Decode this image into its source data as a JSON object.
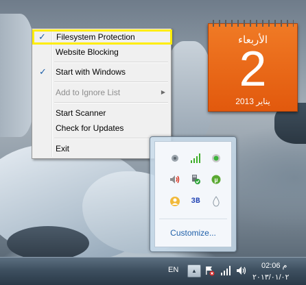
{
  "calendar": {
    "day_name": "الأربعاء",
    "day_number": "2",
    "month_year": "يناير 2013"
  },
  "context_menu": {
    "items": [
      {
        "label": "Filesystem Protection",
        "checked": true,
        "highlighted": true
      },
      {
        "label": "Website Blocking",
        "checked": false
      },
      {
        "label": "Start with Windows",
        "checked": true
      },
      {
        "label": "Add to Ignore List",
        "disabled": true,
        "submenu": true
      },
      {
        "label": "Start Scanner"
      },
      {
        "label": "Check for Updates"
      },
      {
        "label": "Exit"
      }
    ],
    "check_glyph": "✓",
    "submenu_glyph": "▶"
  },
  "tray_flyout": {
    "icons": [
      "antivirus-icon",
      "signal-bars-icon",
      "green-dot-icon",
      "speaker-icon",
      "usb-safe-remove-icon",
      "utorrent-icon",
      "messenger-icon",
      "app-3b-icon",
      "drop-icon"
    ],
    "app_3b_label": "3B",
    "customize_label": "Customize..."
  },
  "taskbar": {
    "language": "EN",
    "show_hidden_glyph": "▲",
    "clock_time": "02:06 م",
    "clock_date": "٢٠١٣/٠١/٠٢"
  },
  "colors": {
    "calendar_orange": "#e2590d",
    "highlight_yellow": "#ffed00",
    "check_blue": "#1c5ea8",
    "link_blue": "#1e5fa9"
  }
}
